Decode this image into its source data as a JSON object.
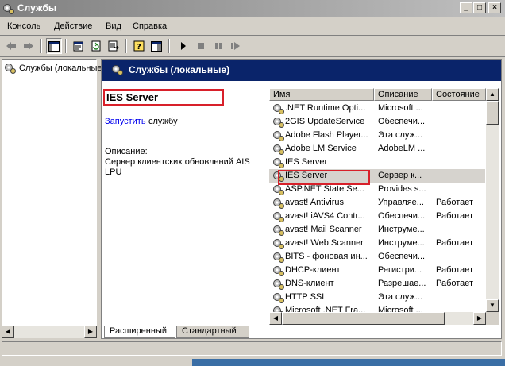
{
  "window": {
    "title": "Службы"
  },
  "menu": {
    "items": [
      "Консоль",
      "Действие",
      "Вид",
      "Справка"
    ]
  },
  "tree": {
    "root_label": "Службы (локальные)"
  },
  "banner": {
    "title": "Службы (локальные)"
  },
  "detail": {
    "service_name": "IES Server",
    "start_link": "Запустить",
    "start_rest": "службу",
    "description_label": "Описание:",
    "description": "Сервер клиентских обновлений AIS LPU"
  },
  "list": {
    "columns": [
      "Имя",
      "Описание",
      "Состояние"
    ],
    "rows": [
      {
        "name": ".NET Runtime Opti...",
        "desc": "Microsoft ...",
        "state": ""
      },
      {
        "name": "2GIS UpdateService",
        "desc": "Обеспечи...",
        "state": ""
      },
      {
        "name": "Adobe Flash Player...",
        "desc": "Эта служ...",
        "state": ""
      },
      {
        "name": "Adobe LM Service",
        "desc": "AdobeLM ...",
        "state": ""
      },
      {
        "name": "IES Server",
        "desc": "",
        "state": ""
      },
      {
        "name": "IES Server",
        "desc": "Сервер к...",
        "state": ""
      },
      {
        "name": "ASP.NET State Se...",
        "desc": "Provides s...",
        "state": ""
      },
      {
        "name": "avast! Antivirus",
        "desc": "Управляе...",
        "state": "Работает"
      },
      {
        "name": "avast! iAVS4 Contr...",
        "desc": "Обеспечи...",
        "state": "Работает"
      },
      {
        "name": "avast! Mail Scanner",
        "desc": "Инструме...",
        "state": ""
      },
      {
        "name": "avast! Web Scanner",
        "desc": "Инструме...",
        "state": "Работает"
      },
      {
        "name": "BITS - фоновая ин...",
        "desc": "Обеспечи...",
        "state": ""
      },
      {
        "name": "DHCP-клиент",
        "desc": "Регистри...",
        "state": "Работает"
      },
      {
        "name": "DNS-клиент",
        "desc": "Разрешае...",
        "state": "Работает"
      },
      {
        "name": "HTTP SSL",
        "desc": "Эта служ...",
        "state": ""
      },
      {
        "name": "Microsoft .NET Fra...",
        "desc": "Microsoft ...",
        "state": ""
      }
    ],
    "selected_index": 5
  },
  "tabs": [
    "Расширенный",
    "Стандартный"
  ],
  "colors": {
    "banner": "#0a246a",
    "highlight": "#d8202a",
    "link": "#0000ee"
  },
  "icons": [
    "services-app-icon",
    "back-icon",
    "forward-icon",
    "show-hide-tree-icon",
    "properties-icon",
    "refresh-icon",
    "export-list-icon",
    "help-icon",
    "console-tree-icon",
    "play-icon",
    "stop-icon",
    "pause-icon",
    "restart-icon",
    "gear-icon"
  ]
}
